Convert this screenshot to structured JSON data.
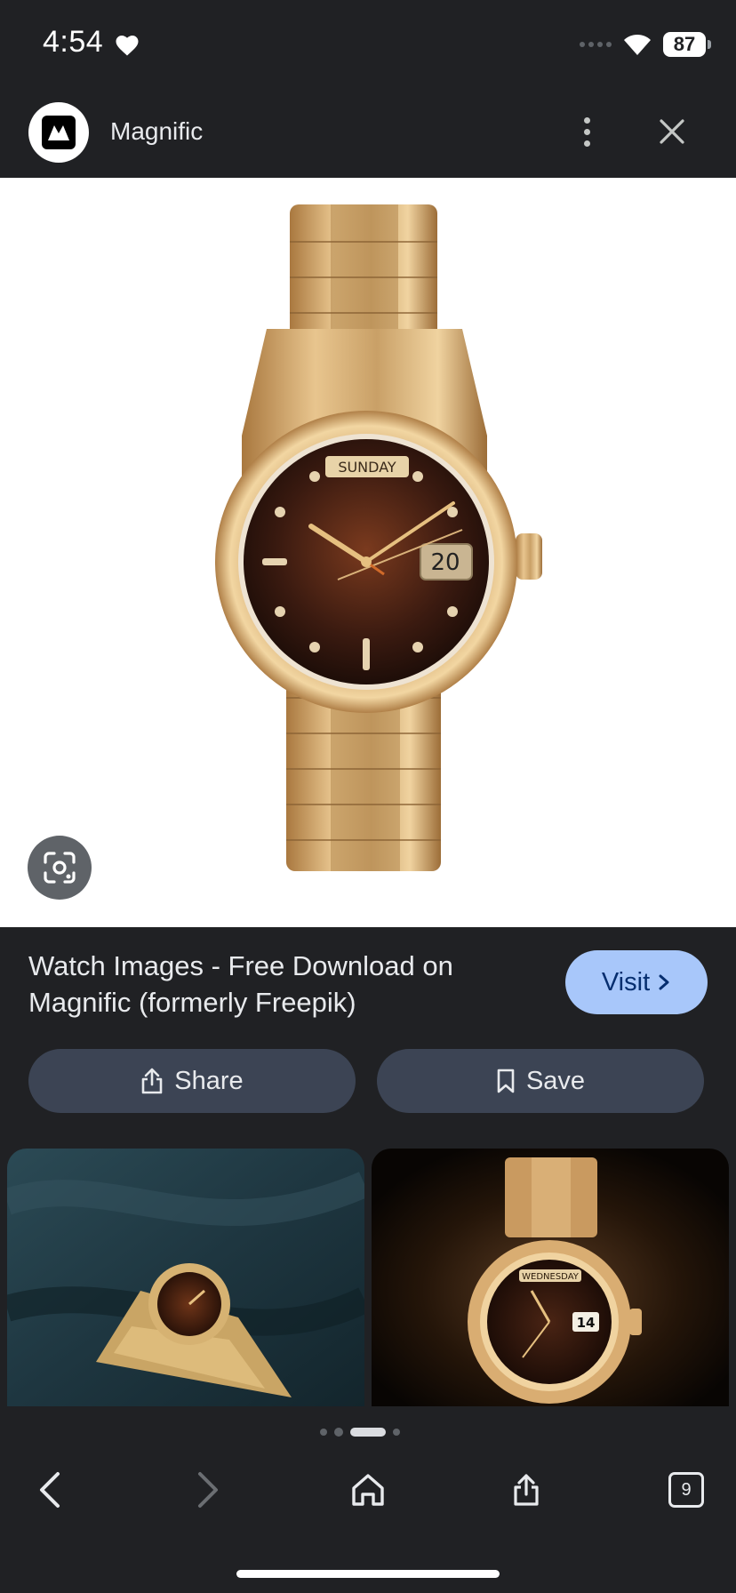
{
  "status_bar": {
    "time": "4:54",
    "battery": "87"
  },
  "header": {
    "site_name": "Magnific"
  },
  "result": {
    "title": "Watch Images - Free Download on Magnific (formerly Freepik)",
    "visit_label": "Visit"
  },
  "actions": {
    "share_label": "Share",
    "save_label": "Save"
  },
  "main_image": {
    "day_label": "SUNDAY",
    "date_label": "20"
  },
  "related_images": [
    {
      "alt": "gold watch on dark fabric"
    },
    {
      "alt": "gold Rolex Day-Date watch",
      "day_label": "WEDNESDAY",
      "date_label": "14"
    }
  ],
  "bottom_nav": {
    "tab_count": "9"
  },
  "colors": {
    "background": "#202124",
    "accent": "#a8c7fa",
    "button": "#3c4454"
  }
}
